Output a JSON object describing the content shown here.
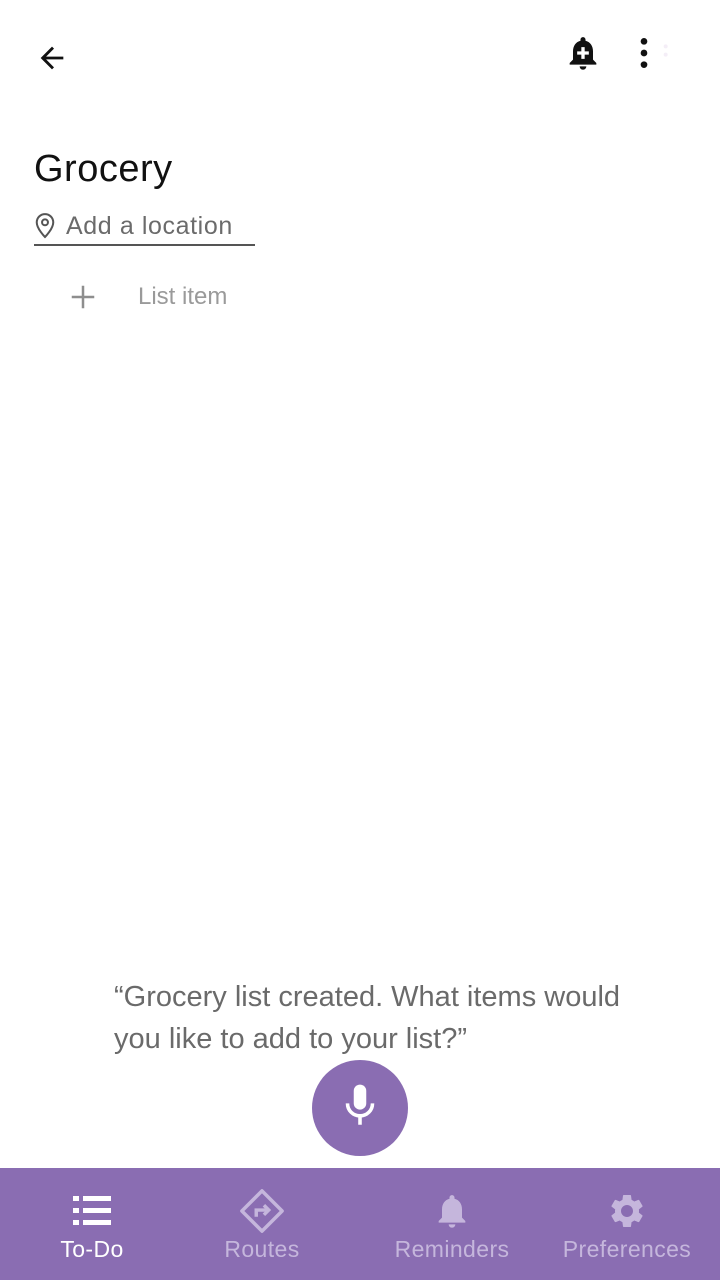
{
  "list": {
    "title": "Grocery",
    "location_placeholder": "Add a location",
    "add_item_placeholder": "List item"
  },
  "assistant": {
    "message": "“Grocery list created. What items would you like to add to your list?”"
  },
  "bottom_nav": {
    "items": [
      {
        "label": "To-Do",
        "icon": "list-icon",
        "active": true
      },
      {
        "label": "Routes",
        "icon": "route-icon",
        "active": false
      },
      {
        "label": "Reminders",
        "icon": "bell-icon",
        "active": false
      },
      {
        "label": "Preferences",
        "icon": "gear-icon",
        "active": false
      }
    ]
  },
  "icons": {
    "back": "arrow-back-icon",
    "add_reminder": "bell-plus-icon",
    "more": "more-vert-icon",
    "location": "location-pin-icon",
    "add": "plus-icon",
    "mic": "mic-icon"
  },
  "colors": {
    "accent": "#8a6db2",
    "nav_active": "#ffffff",
    "nav_inactive": "#c5b6dc",
    "text_primary": "#111111",
    "text_hint": "#9a9a9a"
  }
}
